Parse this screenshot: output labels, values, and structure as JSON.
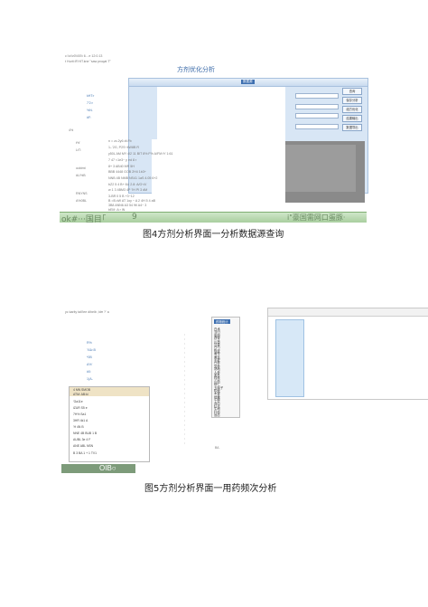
{
  "fig4": {
    "window_title": "方剂优化分析",
    "ribbon_button": "数据源",
    "header_lines": [
      "c:\\\\c\\\\r0\\\\00\\\\ 6…e 12:0.13",
      "t Hurit:IF.HIT.kne \"saw proqat T\""
    ],
    "side_buttons": [
      "查询",
      "保存分析",
      "组方优化",
      "结果输出",
      "数据导出"
    ],
    "field_value": "黄芪",
    "left_labels": [
      "kHT:r",
      "7'2:r",
      "%N.",
      "#F:",
      "4%",
      "t%'",
      "LtT:",
      "ocktmt",
      "#L/%B",
      "RNYNS",
      "A%0BL"
    ],
    "mid_lines": [
      "n = zc.2y6 dt.Fb",
      "1-.'2G, P2S~4W8B R",
      "y50L AM MY 4l2 11 BIT 8% F% A/FM tY 1:61",
      "7 47 <1e3~ y ed 8 r",
      "8+ 3 AB40 MR 5H",
      "BBB 4448 GOB 2H4 1b3+",
      "NNB 4B NMB NS41 1aS 4.05 6+2",
      "bZ2 5 4 B+ 6U 2.8: A/G+A'",
      "w 1 3 4BM3 4P ?H Pl 3 dM",
      "3-BR 0 5 B +3~12",
      "B =B.xW AT 1oy ~ A 2 4H 5 4 aB",
      "3B8 ANN6 A3 54 9t/ A4~ 3",
      "bEM :A r IN"
    ],
    "bottom_text": "ok#···国目｢",
    "bottom_num": "9",
    "bottom_right": "i\"豪国需网口蛋豚·",
    "caption": "图4方剂分析界面一分析数据源查询"
  },
  "fig5": {
    "header_line": "yc karity tall'iee dihelb  ;/d● ?' a",
    "left_labels": [
      "R%",
      "'X&r.B",
      "*0B",
      "A%'",
      "#0:",
      "1(A-"
    ],
    "menu_rows": [
      "4 MN SMOB",
      "ATM:  AB:ki",
      "'Ga11e",
      "iZUR S5 e",
      "7H% Sa1",
      "3HR 4k1 A",
      "'H 4N B",
      "NNE 4B BUB 1 B",
      "AUBL 3e 4 F",
      "ANE ABL NSN",
      "B 3 BA 1 + 1 TV1"
    ],
    "list_items": [
      "药物统计",
      "白术",
      "当归",
      "柴胡",
      "茯苓",
      "川芎",
      "甘草",
      "白芍",
      "陈皮",
      "黄芩",
      "黄芪",
      "半夏",
      "丹参",
      "党参",
      "熟地",
      "人参",
      "麦冬",
      "桂枝",
      "山药",
      "砂仁",
      "五味子",
      "枳壳",
      "木香",
      "地黄",
      "牛膝",
      "赤芍",
      "红花",
      "生地",
      "杜仲",
      "远志"
    ],
    "bottom_text": "OIB○",
    "bottom_label": "B/L",
    "caption": "图5方剂分析界面一用药频次分析"
  }
}
